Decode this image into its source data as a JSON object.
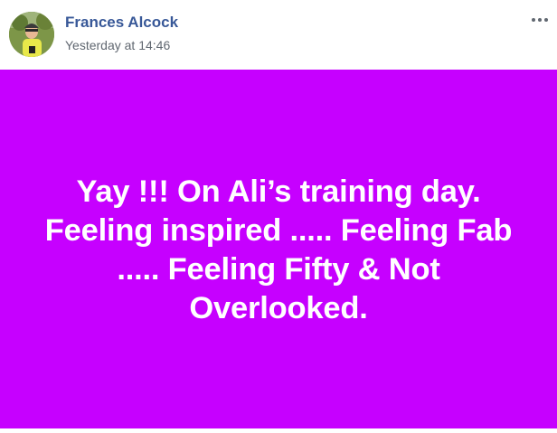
{
  "post": {
    "author": {
      "name": "Frances Alcock",
      "avatar_icon": "profile-photo"
    },
    "timestamp": "Yesterday at 14:46",
    "menu_icon": "more-options-icon",
    "text": "Yay !!! On Ali’s training day. Feeling inspired ..... Feeling Fab ..... Feeling Fifty & Not Overlooked.",
    "background_color": "#c600ff",
    "text_color": "#ffffff",
    "author_name_color": "#385898"
  }
}
